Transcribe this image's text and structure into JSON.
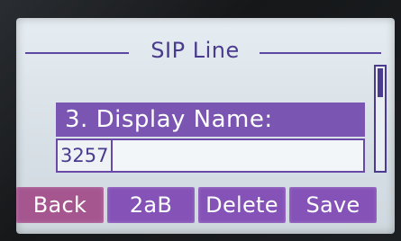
{
  "screen": {
    "title": "SIP Line"
  },
  "field": {
    "label": "3. Display Name:",
    "value": "3257"
  },
  "softkeys": [
    {
      "label": "Back"
    },
    {
      "label": "2aB"
    },
    {
      "label": "Delete"
    },
    {
      "label": "Save"
    }
  ],
  "colors": {
    "accent": "#7b55b2",
    "text": "#4a3b8f",
    "screen_bg": "#dbe3e8"
  }
}
